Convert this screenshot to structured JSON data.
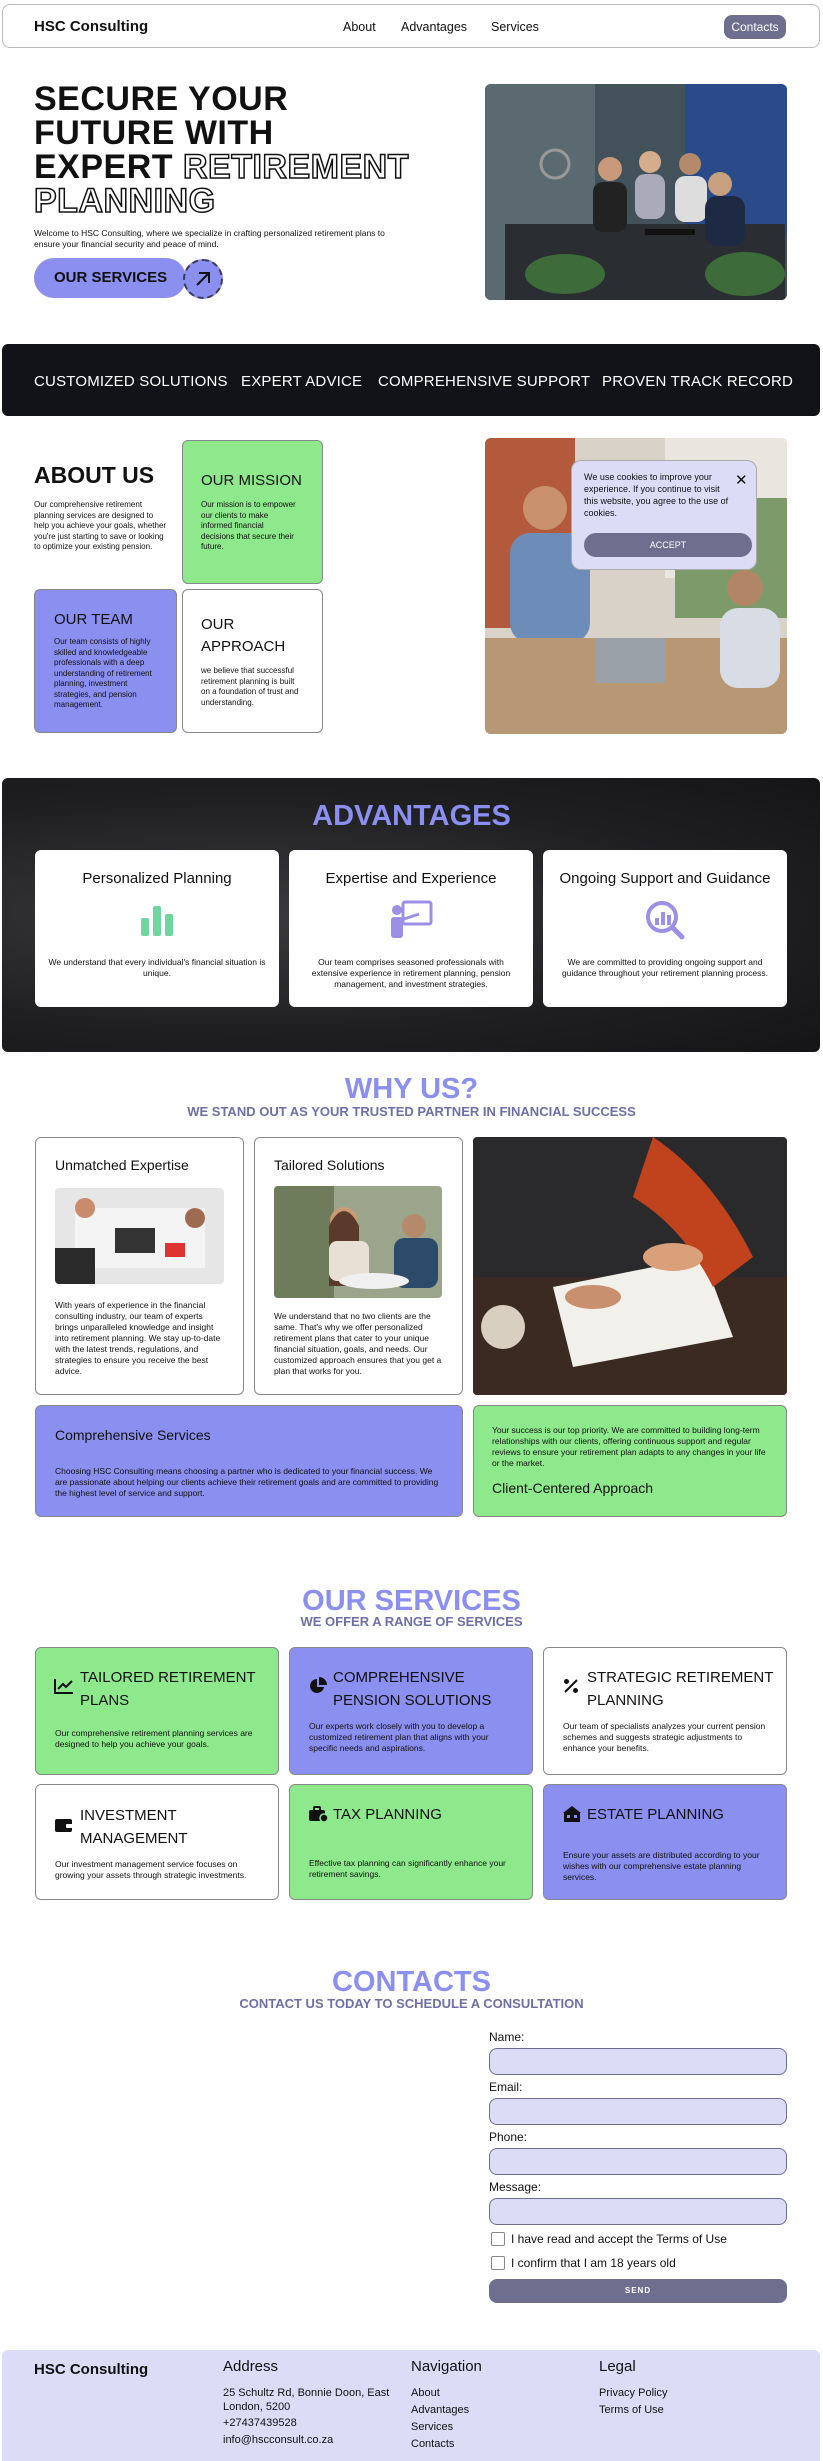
{
  "header": {
    "logo": "HSC Consulting",
    "nav": [
      "About",
      "Advantages",
      "Services"
    ],
    "contacts_button": "Contacts"
  },
  "hero": {
    "title_line1": "SECURE YOUR",
    "title_line2": "FUTURE WITH",
    "title_line3a": "EXPERT ",
    "title_line3b": "RETIREMENT",
    "title_line4": "PLANNING",
    "text": "Welcome to HSC Consulting, where we specialize in crafting personalized retirement plans to ensure your financial security and peace of mind.",
    "button": "OUR SERVICES"
  },
  "band": [
    "CUSTOMIZED SOLUTIONS",
    "EXPERT ADVICE",
    "COMPREHENSIVE SUPPORT",
    "PROVEN TRACK RECORD"
  ],
  "about": {
    "title": "ABOUT US",
    "text": "Our comprehensive retirement planning services are designed to help you achieve your goals, whether you're just starting to save or looking to optimize your existing pension.",
    "mission_title": "OUR MISSION",
    "mission_text": "Our mission is to empower our clients to make informed financial decisions that secure their future.",
    "team_title": "OUR TEAM",
    "team_text": "Our team consists of highly skilled and knowledgeable professionals with a deep understanding of retirement planning, investment strategies, and pension management.",
    "approach_title": "OUR APPROACH",
    "approach_text": "we believe that successful retirement planning is built on a foundation of trust and understanding."
  },
  "cookie": {
    "text": "We use cookies to improve your experience. If you continue to visit this website, you agree to the use of cookies.",
    "close": "✕",
    "accept": "ACCEPT"
  },
  "advantages": {
    "title": "ADVANTAGES",
    "cards": [
      {
        "title": "Personalized Planning",
        "icon": "bar-chart-icon",
        "text": "We understand that every individual's financial situation is unique."
      },
      {
        "title": "Expertise and Experience",
        "icon": "presenter-icon",
        "text": "Our team comprises seasoned professionals with extensive experience in retirement planning, pension management, and investment strategies."
      },
      {
        "title": "Ongoing Support and Guidance",
        "icon": "magnify-chart-icon",
        "text": "We are committed to providing ongoing support and guidance throughout your retirement planning process."
      }
    ]
  },
  "why": {
    "title": "WHY US?",
    "subtitle": "WE STAND OUT AS YOUR TRUSTED PARTNER IN FINANCIAL SUCCESS",
    "expertise_title": "Unmatched Expertise",
    "expertise_text": "With years of experience in the financial consulting industry, our team of experts brings unparalleled knowledge and insight into retirement planning. We stay up-to-date with the latest trends, regulations, and strategies to ensure you receive the best advice.",
    "tailored_title": "Tailored Solutions",
    "tailored_text": "We understand that no two clients are the same. That's why we offer personalized retirement plans that cater to your unique financial situation, goals, and needs. Our customized approach ensures that you get a plan that works for you.",
    "comprehensive_title": "Comprehensive Services",
    "comprehensive_text": "Choosing HSC Consulting means choosing a partner who is dedicated to your financial success. We are passionate about helping our clients achieve their retirement goals and are committed to providing the highest level of service and support.",
    "client_text": "Your success is our top priority. We are committed to building long-term relationships with our clients, offering continuous support and regular reviews to ensure your retirement plan adapts to any changes in your life or the market.",
    "client_title": "Client-Centered Approach"
  },
  "services": {
    "title": "OUR SERVICES",
    "subtitle": "WE OFFER A RANGE OF SERVICES",
    "cards": [
      {
        "title": "TAILORED RETIREMENT PLANS",
        "icon": "trend-icon",
        "text": "Our comprehensive retirement planning services are designed to help you achieve your goals."
      },
      {
        "title": "COMPREHENSIVE PENSION SOLUTIONS",
        "icon": "pie-chart-icon",
        "text": "Our experts work closely with you to develop a customized retirement plan that aligns with your specific needs and aspirations."
      },
      {
        "title": "STRATEGIC RETIREMENT PLANNING",
        "icon": "percent-icon",
        "text": "Our team of specialists analyzes your current pension schemes and suggests strategic adjustments to enhance your benefits."
      },
      {
        "title": "INVESTMENT MANAGEMENT",
        "icon": "wallet-icon",
        "text": "Our investment management service focuses on growing your assets through strategic investments."
      },
      {
        "title": "TAX PLANNING",
        "icon": "tax-icon",
        "text": "Effective tax planning can significantly enhance your retirement savings."
      },
      {
        "title": "ESTATE PLANNING",
        "icon": "estate-icon",
        "text": "Ensure your assets are distributed according to your wishes with our comprehensive estate planning services."
      }
    ]
  },
  "contacts": {
    "title": "CONTACTS",
    "subtitle": "CONTACT US TODAY TO SCHEDULE A CONSULTATION",
    "name_label": "Name:",
    "email_label": "Email:",
    "phone_label": "Phone:",
    "message_label": "Message:",
    "terms_label": "I have read and accept the Terms of Use",
    "age_label": "I confirm that I am 18 years old",
    "send": "SEND"
  },
  "footer": {
    "logo": "HSC Consulting",
    "address_title": "Address",
    "address_line1": "25 Schultz Rd, Bonnie Doon, East London, 5200",
    "phone": "+27437439528",
    "email": "info@hscconsult.co.za",
    "nav_title": "Navigation",
    "nav": [
      "About",
      "Advantages",
      "Services",
      "Contacts"
    ],
    "legal_title": "Legal",
    "legal": [
      "Privacy Policy",
      "Terms of Use"
    ]
  },
  "colors": {
    "accent_purple": "#8b8ff0",
    "accent_green": "#8ee88c",
    "button_gray": "#6e6f8f",
    "light_lavender": "#dcdcf7"
  }
}
